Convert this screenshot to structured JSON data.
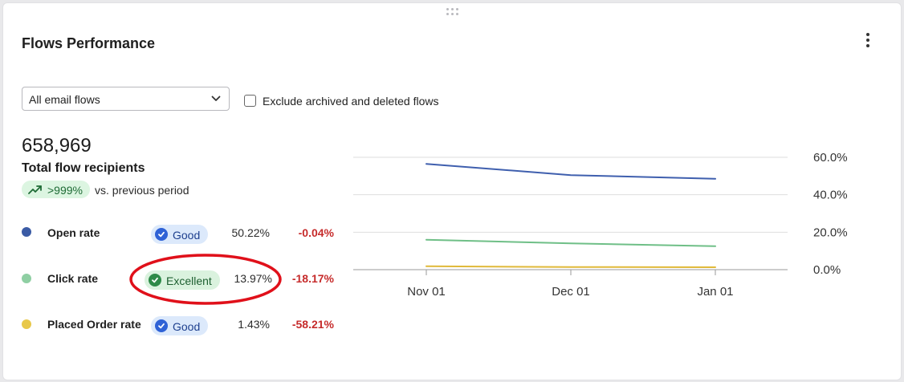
{
  "widget": {
    "title": "Flows Performance",
    "menu_icon": "more-vertical-icon",
    "drag_icon": "drag-grip-icon"
  },
  "filters": {
    "flow_select": {
      "selected": "All email flows",
      "icon": "chevron-down-icon"
    },
    "exclude_checkbox": {
      "label": "Exclude archived and deleted flows",
      "checked": false
    }
  },
  "summary": {
    "value": "658,969",
    "label": "Total flow recipients",
    "trend": {
      "value": ">999%",
      "icon": "trend-up-icon",
      "suffix": "vs. previous period"
    }
  },
  "metrics": [
    {
      "name": "Open rate",
      "color": "#3b5ba5",
      "badge": "Good",
      "badge_type": "good",
      "value": "50.22%",
      "delta": "-0.04%"
    },
    {
      "name": "Click rate",
      "color": "#8fcfa3",
      "badge": "Excellent",
      "badge_type": "excellent",
      "value": "13.97%",
      "delta": "-18.17%"
    },
    {
      "name": "Placed Order rate",
      "color": "#e8c84a",
      "badge": "Good",
      "badge_type": "good",
      "value": "1.43%",
      "delta": "-58.21%"
    }
  ],
  "chart_data": {
    "type": "line",
    "x": [
      "Nov 01",
      "Dec 01",
      "Jan 01"
    ],
    "x_ticks": [
      "Nov 01",
      "Dec 01",
      "Jan 01"
    ],
    "y_ticks": [
      "60.0%",
      "40.0%",
      "20.0%",
      "0.0%"
    ],
    "ylim": [
      0,
      60
    ],
    "y_axis_position": "right",
    "grid": true,
    "series": [
      {
        "color": "#3f5fae",
        "values": [
          56.5,
          50.5,
          48.5
        ]
      },
      {
        "color": "#6fbf87",
        "values": [
          16.0,
          14.0,
          12.5
        ]
      },
      {
        "color": "#e0b93a",
        "values": [
          1.8,
          1.4,
          1.3
        ]
      }
    ]
  },
  "annotation_color": "#e0101a"
}
